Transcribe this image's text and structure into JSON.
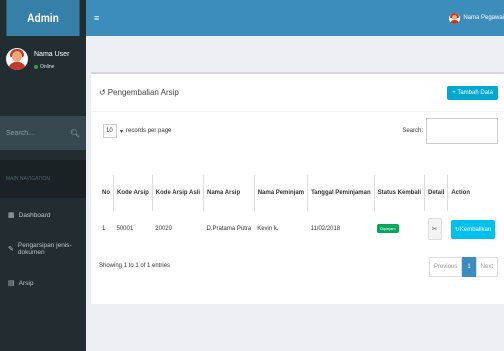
{
  "app": {
    "brand": "Admin",
    "top_user_name": "Nama Pegawai"
  },
  "sidebar": {
    "user_name": "Nama User",
    "user_status": "Online",
    "search_placeholder": "Search...",
    "nav_header": "MAIN NAVIGATION",
    "items": [
      {
        "label": "Dashboard",
        "icon": "dashboard-icon"
      },
      {
        "label": "Pengarsipan jenis-dokumen",
        "icon": "edit-icon"
      },
      {
        "label": "Arsip",
        "icon": "file-icon"
      }
    ]
  },
  "box": {
    "title": "Pengembalian Arsip",
    "add_label": "+ Tambah Data",
    "records_value": "10",
    "records_label": "records per page",
    "search_label": "Search:",
    "columns": [
      "No",
      "Kode Arsip",
      "Kode Arsip Asli",
      "Nama Arsip",
      "Nama Peminjam",
      "Tanggal Peminjaman",
      "Status Kembali",
      "Detail",
      "Action"
    ],
    "rows": [
      {
        "no": "1",
        "kode": "50001",
        "kode_asli": "20020",
        "nama_arsip": "D.Pratama Putra",
        "peminjam": "Kevin k.",
        "tanggal": "11/02/2018",
        "status": "Dipinjam",
        "action": "Kembalikan"
      }
    ],
    "info": "Showing 1 to 1 of 1 entries",
    "pagination": {
      "previous": "Previous",
      "page": "1",
      "next": "Next"
    }
  },
  "colors": {
    "header": "#3c8dbc",
    "sidebar": "#222d32",
    "badge": "#00a65a",
    "action": "#00c0ef"
  }
}
